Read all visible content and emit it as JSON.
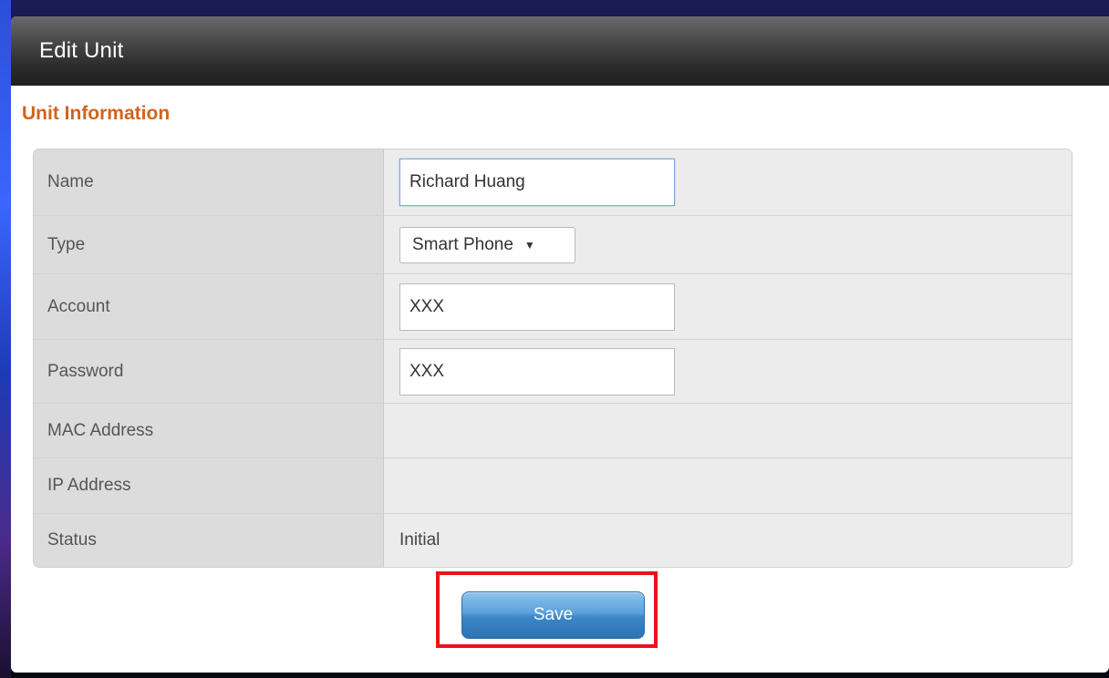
{
  "dialog": {
    "title": "Edit Unit",
    "section_title": "Unit Information"
  },
  "form": {
    "name": {
      "label": "Name",
      "value": "Richard Huang"
    },
    "type": {
      "label": "Type",
      "selected": "Smart Phone",
      "arrow_icon": "triangle-down"
    },
    "account": {
      "label": "Account",
      "value": "XXX"
    },
    "password": {
      "label": "Password",
      "value": "XXX"
    },
    "mac_address": {
      "label": "MAC Address",
      "value": ""
    },
    "ip_address": {
      "label": "IP Address",
      "value": ""
    },
    "status": {
      "label": "Status",
      "value": "Initial"
    }
  },
  "actions": {
    "save_label": "Save"
  },
  "colors": {
    "section_title": "#d0641d",
    "highlight_box": "#e8141b",
    "save_button": "#4a93d2"
  }
}
